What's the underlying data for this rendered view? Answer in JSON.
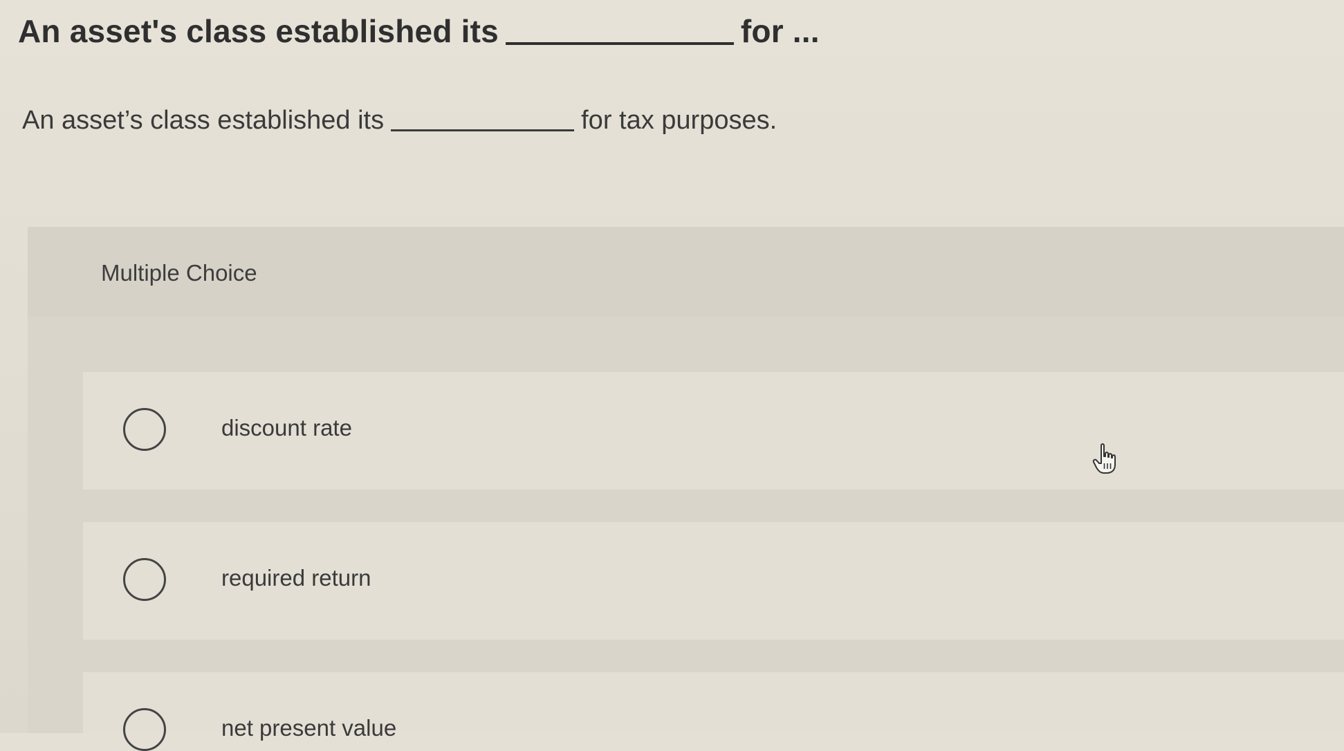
{
  "question": {
    "title_before": "An asset's class established its",
    "title_after": "for ...",
    "prompt_before": "An asset’s class established its",
    "prompt_after": "for tax purposes."
  },
  "multiple_choice": {
    "label": "Multiple Choice",
    "options": [
      {
        "label": "discount rate"
      },
      {
        "label": "required return"
      },
      {
        "label": "net present value"
      }
    ]
  },
  "icons": {
    "cursor": "hand-pointer-icon",
    "radio": "radio-unselected-icon"
  },
  "colors": {
    "background": "#e4e0d6",
    "panel": "#d9d5cb",
    "text": "#3d3d3d"
  }
}
